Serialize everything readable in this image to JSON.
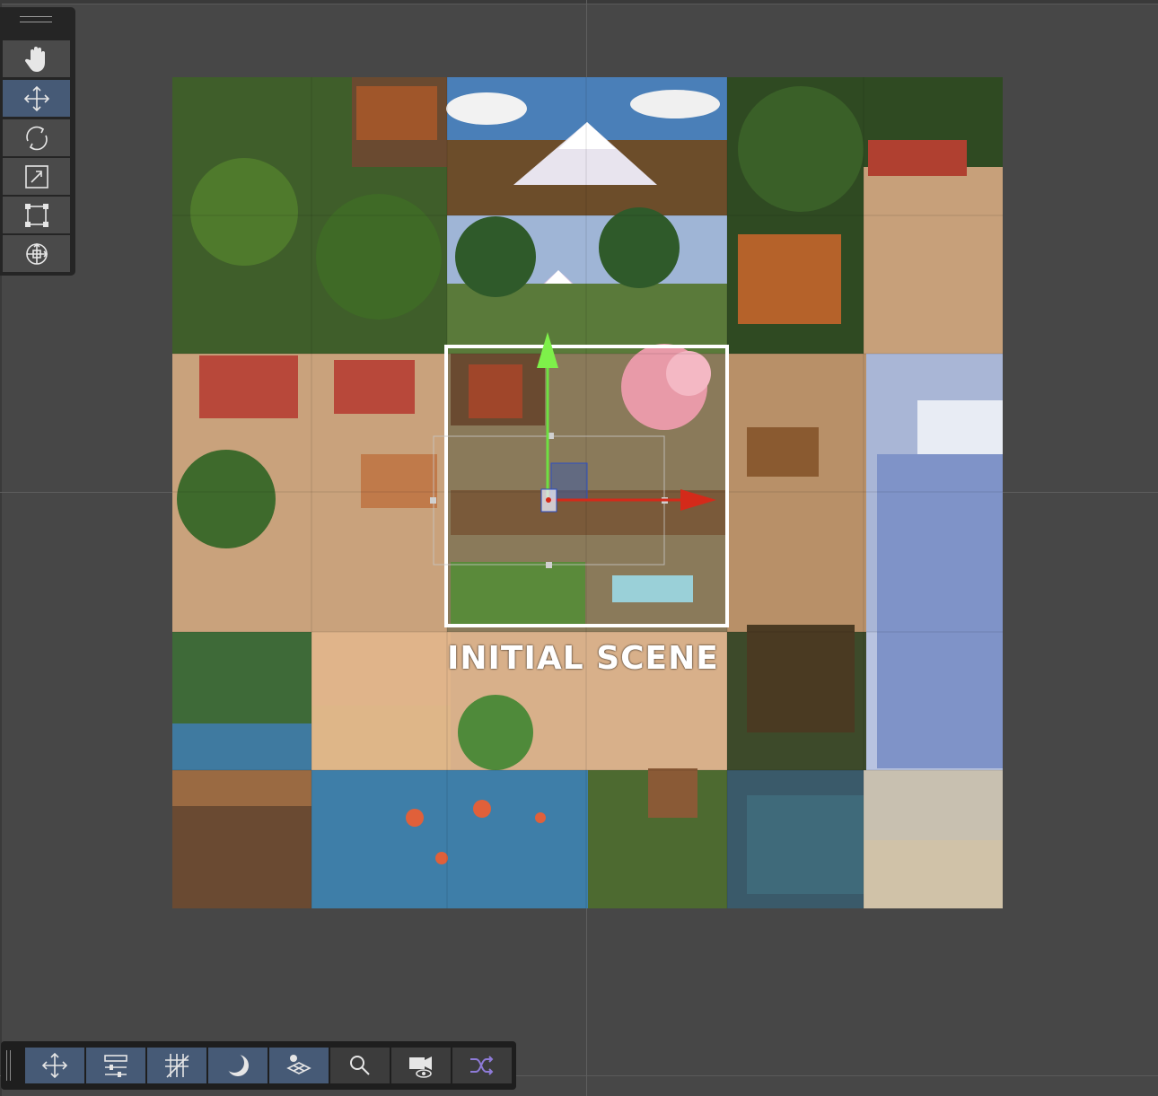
{
  "scene": {
    "label": "INITIAL SCENE"
  },
  "tools": [
    {
      "name": "hand-tool",
      "icon": "hand-icon",
      "active": false
    },
    {
      "name": "move-tool",
      "icon": "move-arrows-icon",
      "active": true
    },
    {
      "name": "rotate-tool",
      "icon": "rotate-icon",
      "active": false
    },
    {
      "name": "scale-tool",
      "icon": "scale-icon",
      "active": false
    },
    {
      "name": "rect-tool",
      "icon": "rect-transform-icon",
      "active": false
    },
    {
      "name": "transform-tool",
      "icon": "transform-all-icon",
      "active": false
    }
  ],
  "bottom_toolbar": [
    {
      "name": "move-tool",
      "icon": "move-arrows-icon",
      "active": true
    },
    {
      "name": "adjustments",
      "icon": "sliders-icon",
      "active": true
    },
    {
      "name": "grid-snapping",
      "icon": "grid-hash-icon",
      "active": true
    },
    {
      "name": "lighting",
      "icon": "moon-icon",
      "active": true
    },
    {
      "name": "layers",
      "icon": "layers-icon",
      "active": true
    },
    {
      "name": "search",
      "icon": "magnifier-icon",
      "active": false
    },
    {
      "name": "camera-visibility",
      "icon": "camera-eye-icon",
      "active": false
    },
    {
      "name": "shuffle",
      "icon": "shuffle-icon",
      "active": false
    }
  ],
  "colors": {
    "viewport_bg": "#474747",
    "active_tool": "#465a76",
    "axis_x": "#d42a1a",
    "axis_y": "#6fe042",
    "selection": "#ffffff"
  }
}
